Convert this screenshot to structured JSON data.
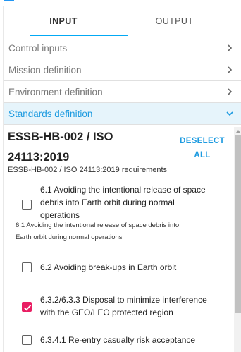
{
  "tabs": [
    {
      "label": "INPUT",
      "active": true
    },
    {
      "label": "OUTPUT",
      "active": false
    }
  ],
  "sections": [
    {
      "label": "Control inputs",
      "open": false,
      "icon": "chevron-right-icon"
    },
    {
      "label": "Mission definition",
      "open": false,
      "icon": "chevron-right-icon"
    },
    {
      "label": "Environment definition",
      "open": false,
      "icon": "chevron-right-icon"
    },
    {
      "label": "Standards definition",
      "open": true,
      "icon": "chevron-down-icon"
    }
  ],
  "standard": {
    "title_line1": "ESSB-HB-002 / ISO",
    "title_line2": "24113:2019",
    "deselect_line1": "DESELECT",
    "deselect_line2": "ALL",
    "subtitle": "ESSB-HB-002 / ISO 24113:2019 requirements"
  },
  "requirements": [
    {
      "lines": [
        "6.1 Avoiding the intentional release of space",
        "debris into Earth orbit during normal",
        "operations"
      ],
      "checked": false,
      "description": [
        "6.1 Avoiding the intentional release of space debris into",
        "Earth orbit during normal operations"
      ]
    },
    {
      "lines": [
        "6.2 Avoiding break-ups in Earth orbit"
      ],
      "checked": false
    },
    {
      "lines": [
        "6.3.2/6.3.3 Disposal to minimize interference",
        "with the GEO/LEO protected region"
      ],
      "checked": true
    },
    {
      "lines": [
        "6.3.4.1 Re-entry casualty risk acceptance"
      ],
      "checked": false
    }
  ],
  "colors": {
    "accent": "#1e9be0",
    "checked": "#e91e63",
    "open_section_bg": "#e6f4fb"
  }
}
